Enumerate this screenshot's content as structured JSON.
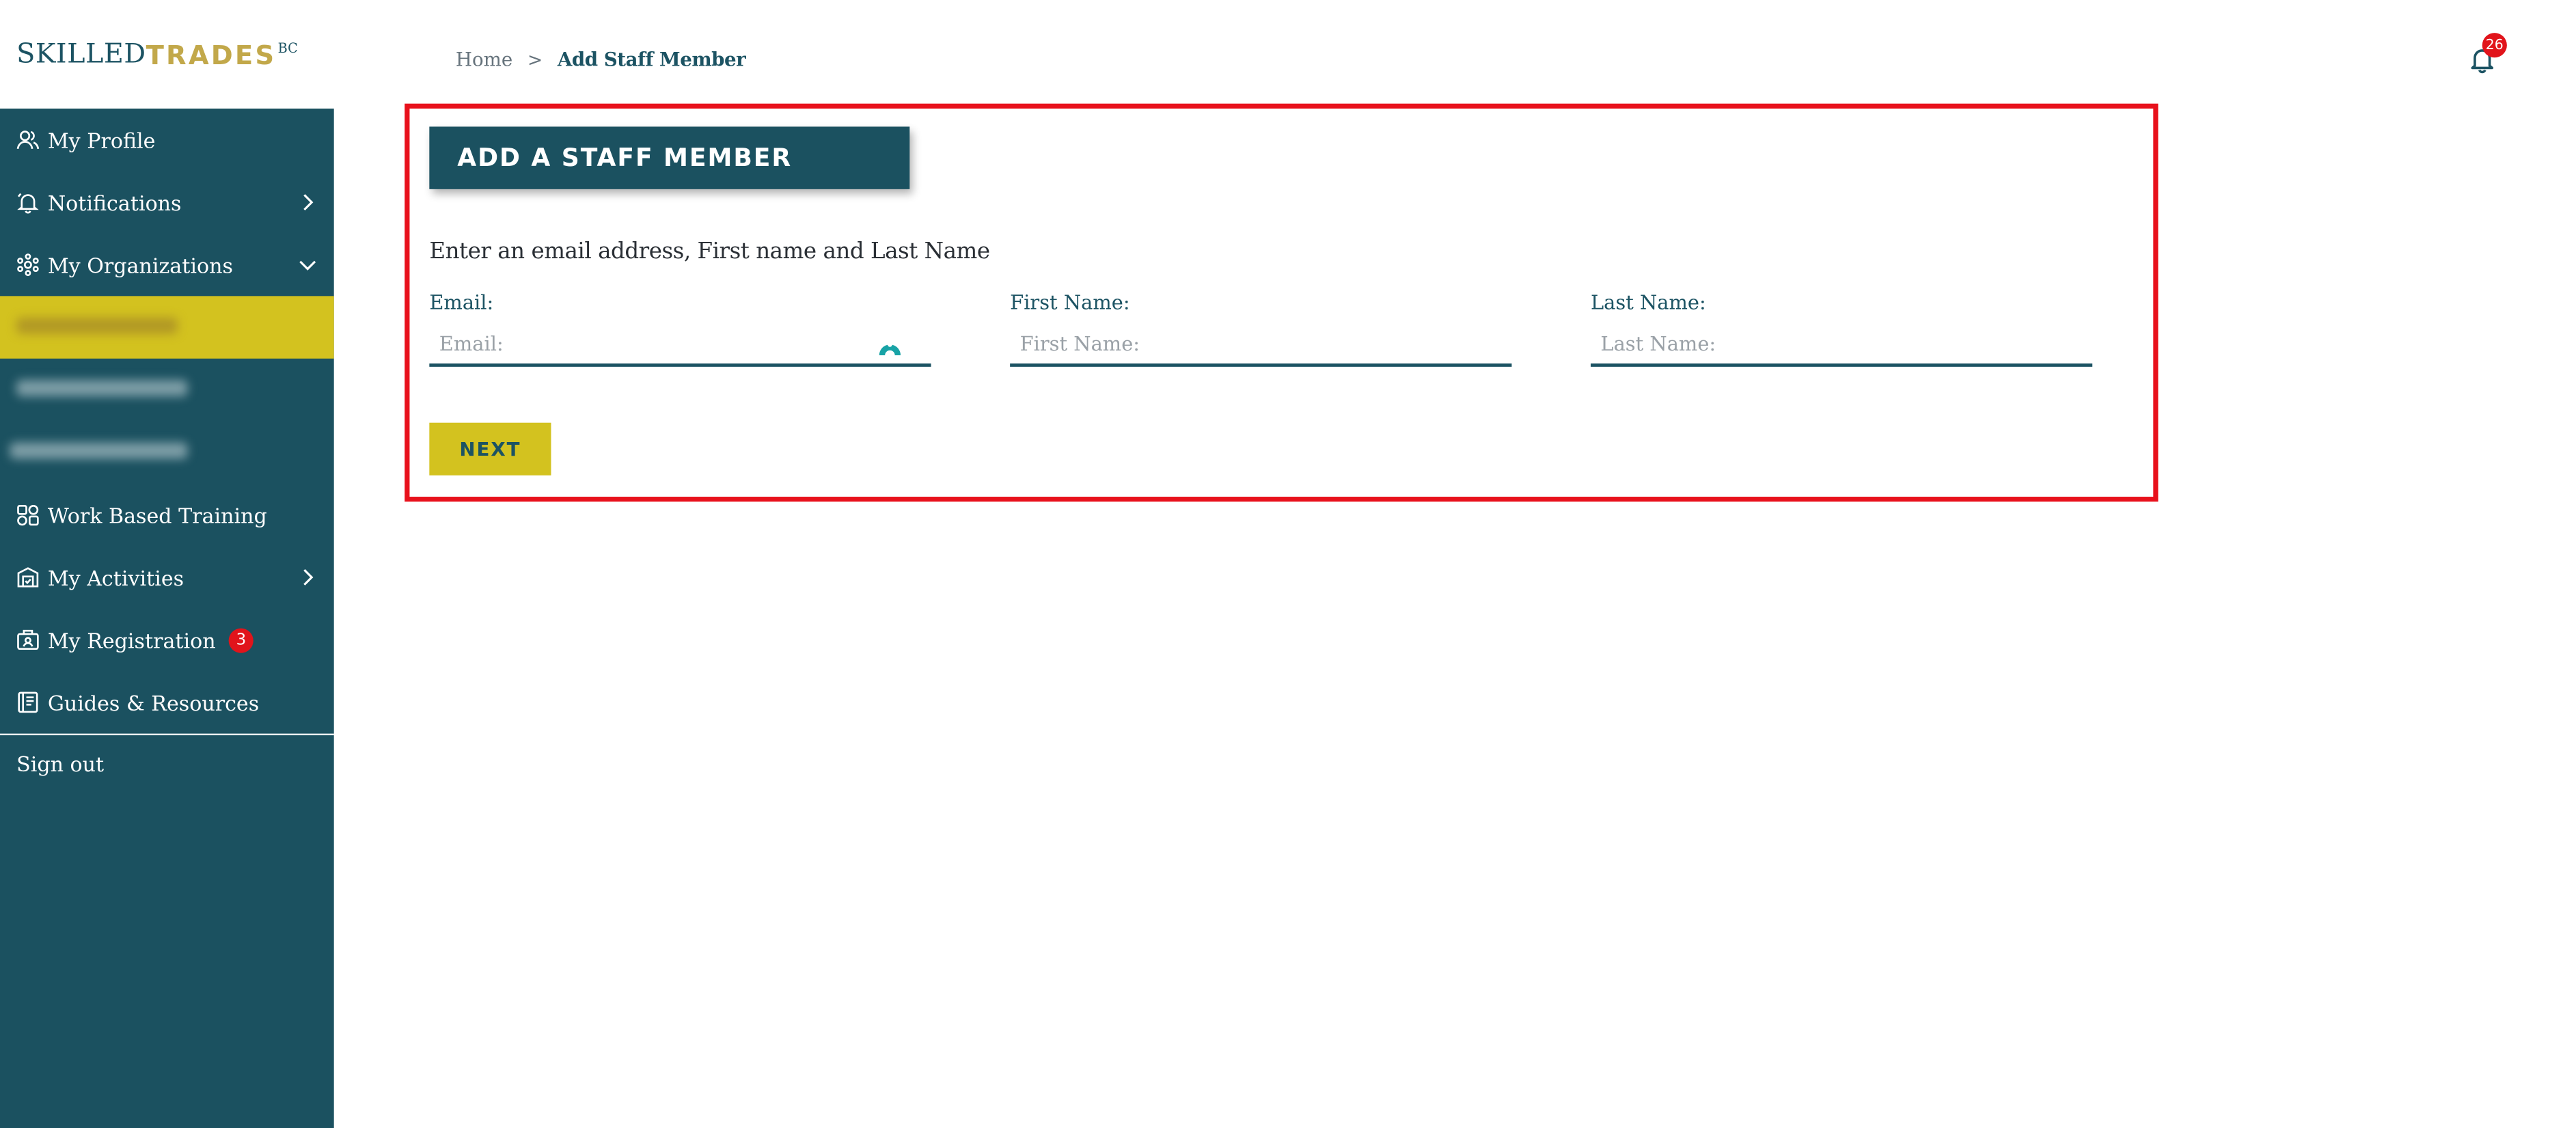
{
  "logo": {
    "part1": "SKILLED",
    "part2": "TRADES",
    "suffix": "BC"
  },
  "breadcrumb": {
    "home": "Home",
    "separator": ">",
    "current": "Add Staff Member"
  },
  "notifications": {
    "count": "26"
  },
  "sidebar": {
    "my_profile": "My Profile",
    "notifications": "Notifications",
    "my_organizations": "My Organizations",
    "work_based_training": "Work Based Training",
    "my_activities": "My Activities",
    "my_registration": "My Registration",
    "my_registration_badge": "3",
    "guides_resources": "Guides & Resources",
    "sign_out": "Sign out"
  },
  "form": {
    "heading": "ADD A STAFF MEMBER",
    "instruction": "Enter an email address, First name and Last Name",
    "email_label": "Email:",
    "email_placeholder": "Email:",
    "first_name_label": "First Name:",
    "first_name_placeholder": "First Name:",
    "last_name_label": "Last Name:",
    "last_name_placeholder": "Last Name:",
    "next_label": "NEXT"
  },
  "colors": {
    "sidebar_bg": "#1b5160",
    "accent_yellow": "#d3c21f",
    "brand_gold": "#c2a84a",
    "highlight_red": "#e8111c",
    "badge_red": "#e1141b"
  }
}
